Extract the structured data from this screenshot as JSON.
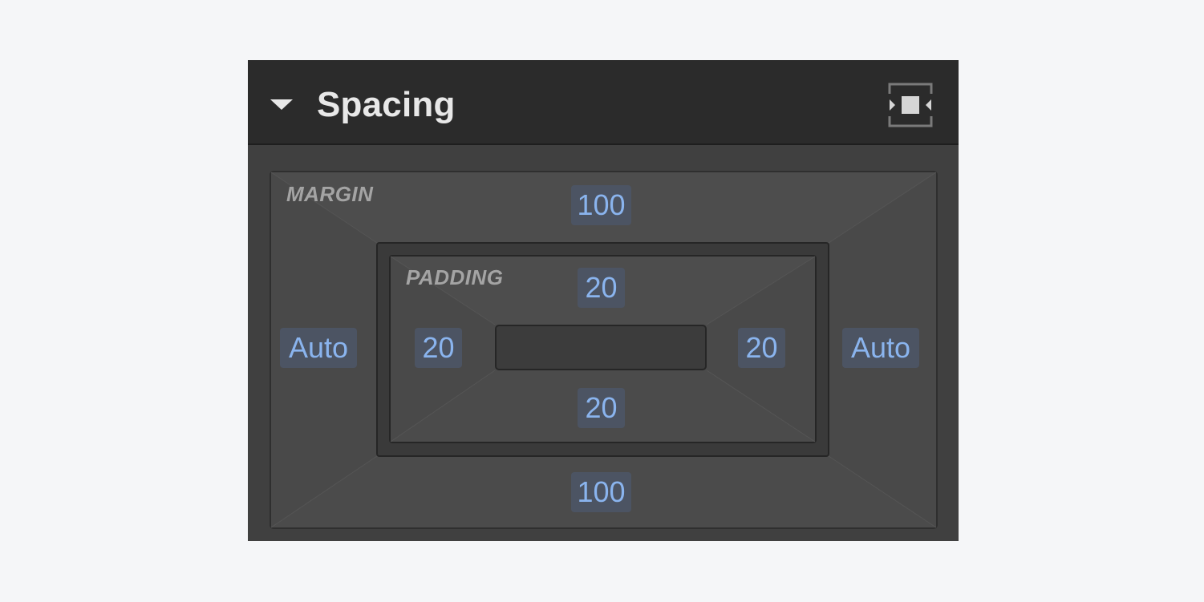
{
  "panel": {
    "title": "Spacing",
    "icons": {
      "collapse": "caret-down-icon",
      "mode": "spacing-box-icon"
    }
  },
  "margin": {
    "label": "MARGIN",
    "top": "100",
    "bottom": "100",
    "left": "Auto",
    "right": "Auto"
  },
  "padding": {
    "label": "PADDING",
    "top": "20",
    "bottom": "20",
    "left": "20",
    "right": "20"
  },
  "colors": {
    "header_bg": "#2b2b2b",
    "panel_bg": "#404040",
    "value_text": "#8ab4ee",
    "value_bg": "#4c5463"
  }
}
